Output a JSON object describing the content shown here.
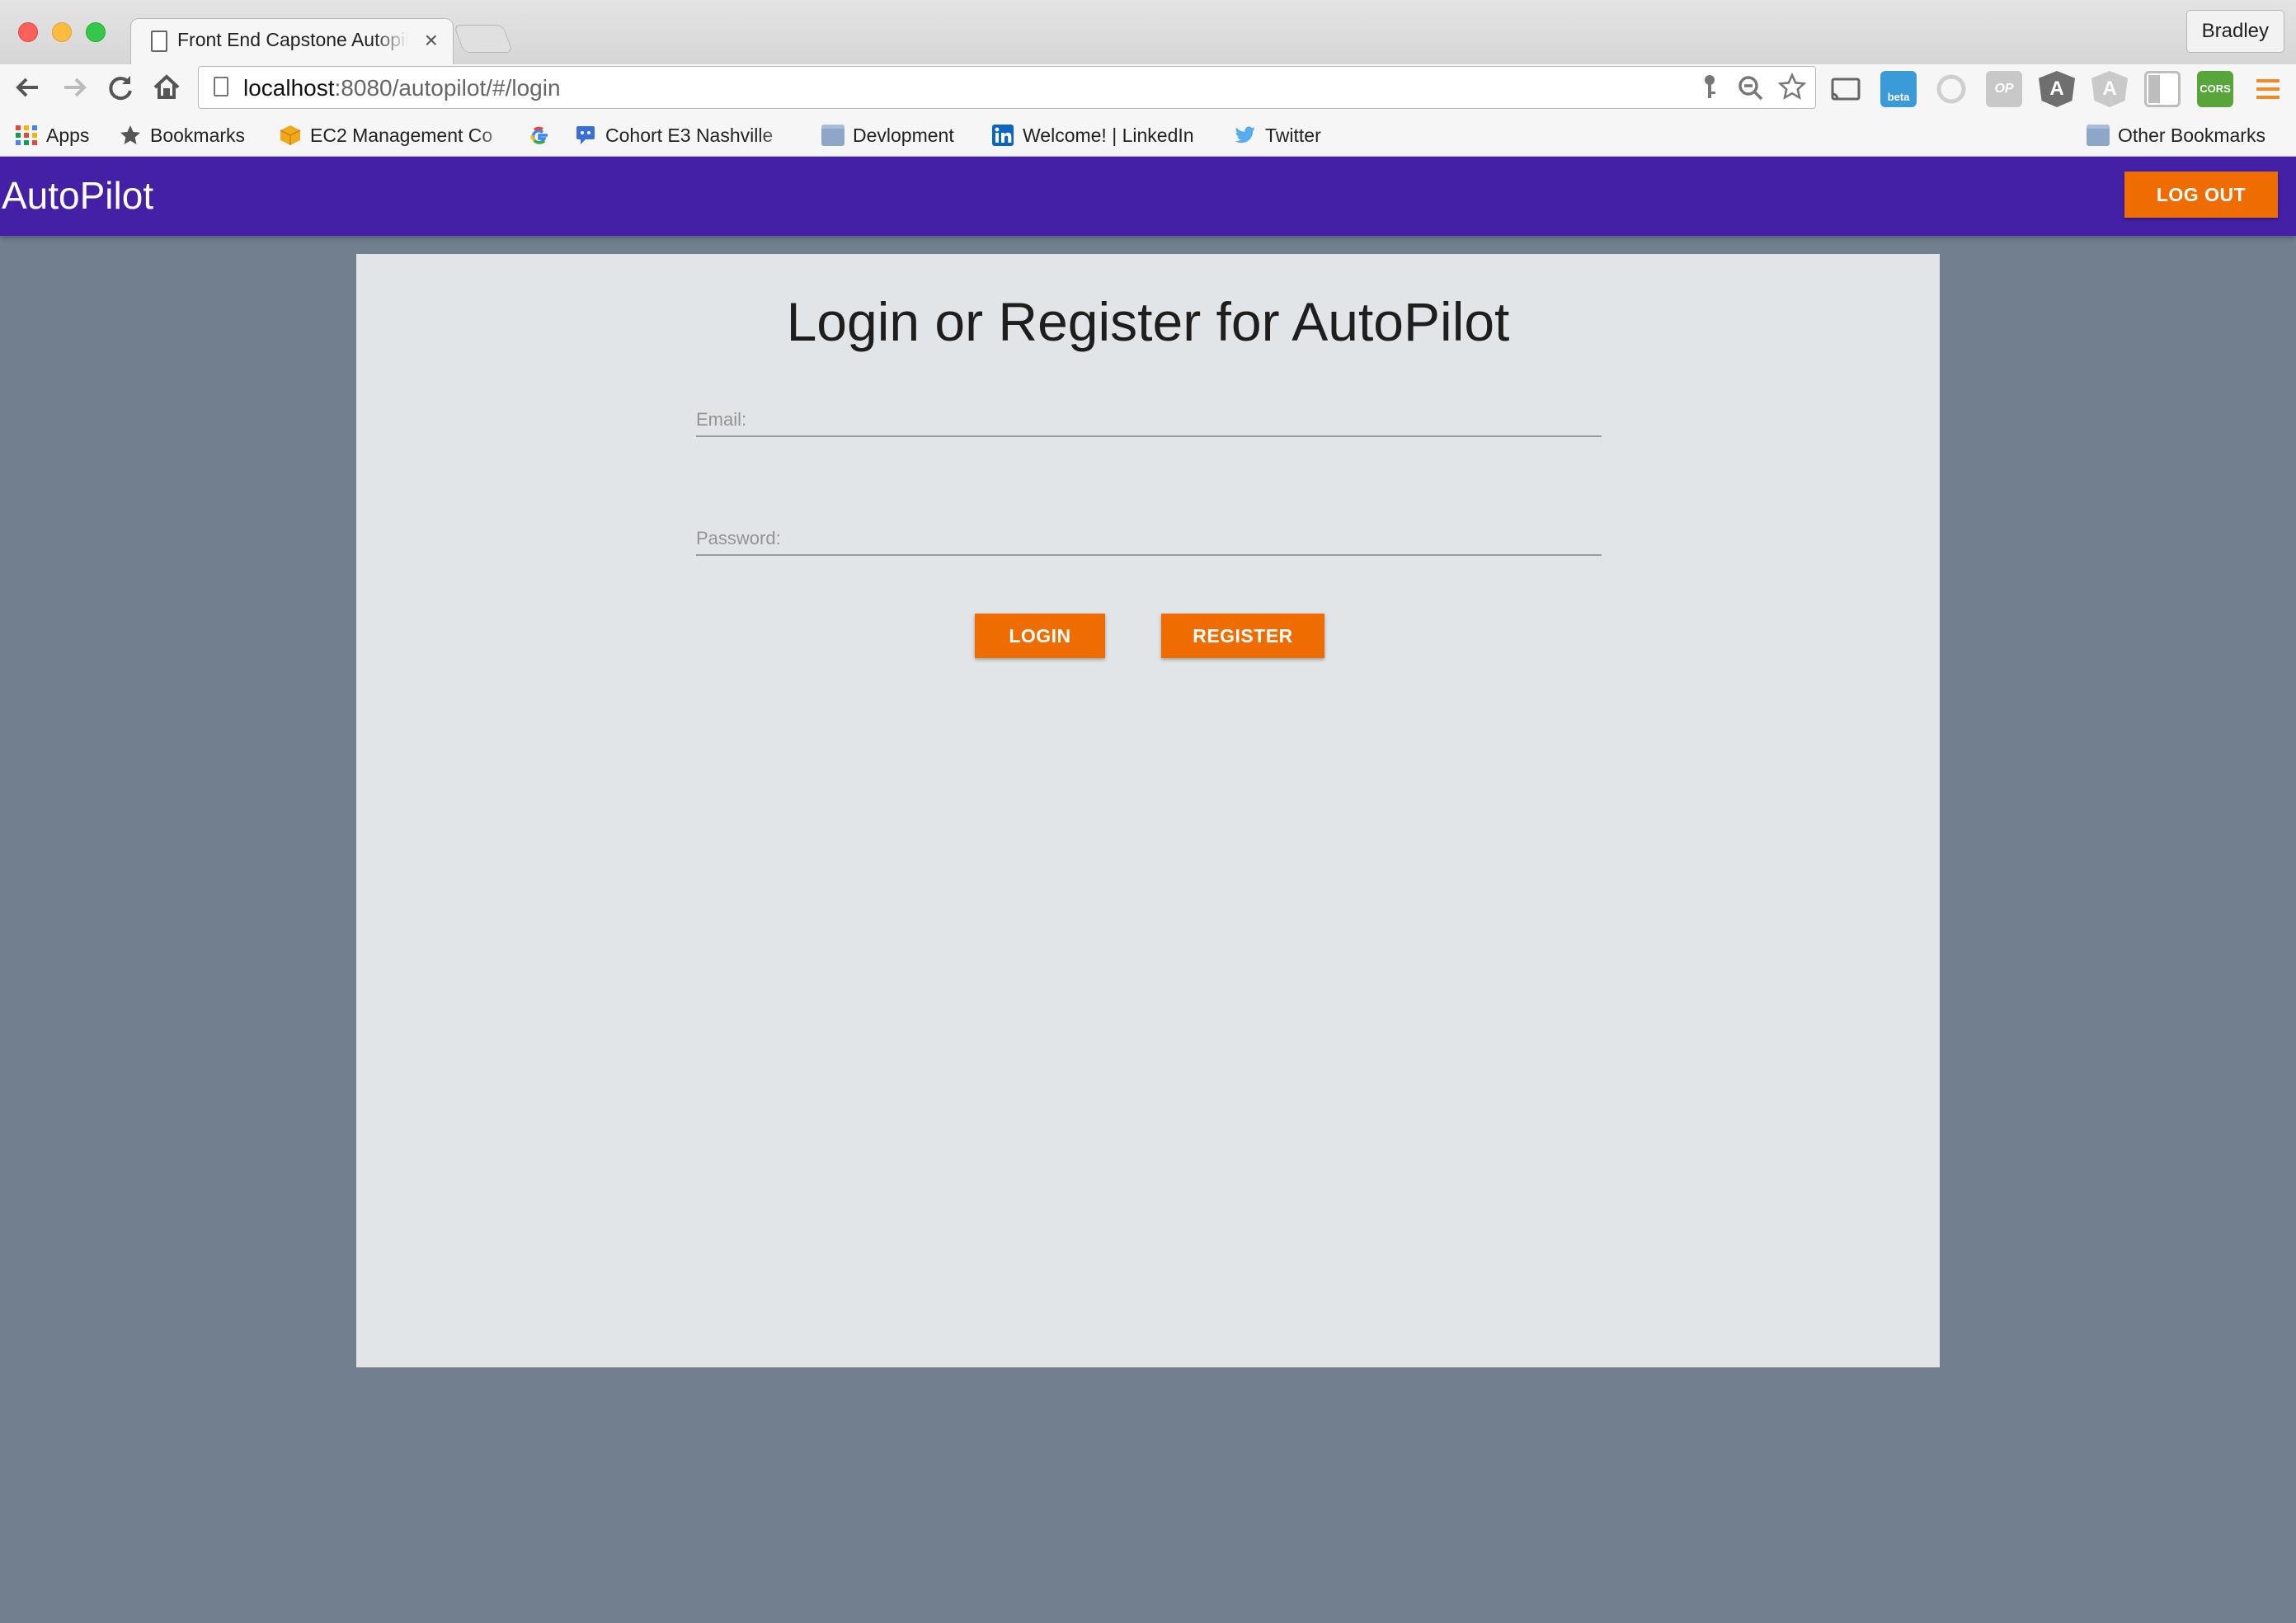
{
  "browser": {
    "tab_title": "Front End Capstone Autopilot",
    "tab_close": "×",
    "profile_name": "Bradley",
    "url_host": "localhost",
    "url_path": ":8080/autopilot/#/login",
    "icons": [
      "back-icon",
      "forward-icon",
      "reload-icon",
      "home-icon",
      "key-icon",
      "zoom-icon",
      "star-icon",
      "cast-icon",
      "menu-icon"
    ],
    "extensions": [
      {
        "name": "beta",
        "color": "#3b9bd8"
      },
      {
        "name": "",
        "color": "#d8d8d8"
      },
      {
        "name": "OP",
        "color": "#c8c8c8"
      },
      {
        "name": "A",
        "color": "#6f6f6f"
      },
      {
        "name": "A",
        "color": "#c9c9c9"
      },
      {
        "name": "",
        "color": "#bdbdbd"
      },
      {
        "name": "CORS",
        "color": "#58a53a"
      }
    ],
    "bookmarks": {
      "apps": "Apps",
      "bookmarks": "Bookmarks",
      "ec2": "EC2 Management Co",
      "cohort": "Cohort E3 Nashville",
      "devlopment": "Devlopment",
      "linkedin": "Welcome! | LinkedIn",
      "twitter": "Twitter",
      "other": "Other Bookmarks"
    }
  },
  "app": {
    "brand": "AutoPilot",
    "logout_label": "LOG OUT",
    "title": "Login or Register for AutoPilot",
    "email_placeholder": "Email:",
    "password_placeholder": "Password:",
    "login_label": "LOGIN",
    "register_label": "REGISTER",
    "colors": {
      "header": "#4320a6",
      "accent": "#ef6c00",
      "background": "#717f8f",
      "card": "#e1e5e8"
    }
  }
}
